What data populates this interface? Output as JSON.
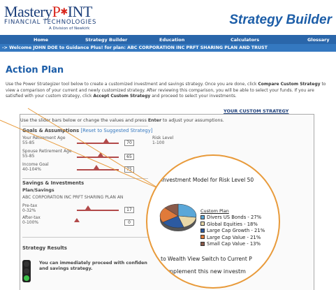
{
  "logo": {
    "name_a": "Mastery",
    "name_star": "P",
    "name_b": "INT",
    "sub": "FINANCIAL TECHNOLOGIES",
    "division": "A Division of Newkirk"
  },
  "brand": "Strategy Builder",
  "nav": [
    "Home",
    "Strategy Builder",
    "Education",
    "Calculators",
    "Glossary"
  ],
  "welcome": "-> Welcome JOHN DOE to Guidance Plus! for plan: ABC CORPORATION INC PRFT SHARING PLAN AND TRUST",
  "page_title": "Action Plan",
  "intro": {
    "p1": "Use the Power Strategizer tool below to create a customized investment and savings strategy. Once you are done, click ",
    "p1_bold": "Compare Custom Strategy",
    "p2": " to view a comparison of your current and newly customized strategy. After reviewing this comparison, you will be able to select your funds. If you are satisfied with your custom strategy, click ",
    "p2_bold": "Accept Custom Strategy",
    "p3": " and proceed to select your investments."
  },
  "your_custom_strategy": "YOUR CUSTOM STRATEGY",
  "instruction_a": "Use the slider bars below or change the values and press ",
  "instruction_bold": "Enter",
  "instruction_b": " to adjust your assumptions.",
  "goals": {
    "heading": "Goals & Assumptions",
    "reset_link": "[Reset to Suggested Strategy]",
    "retirement_age": {
      "label": "Your Retirement Age",
      "range": "55-85",
      "value": "70"
    },
    "spouse_age": {
      "label": "Spouse Retirement Age",
      "range": "55-85",
      "value": "65"
    },
    "income_goal": {
      "label": "Income Goal",
      "range": "40-104%",
      "value": "75"
    },
    "risk_level": {
      "label": "Risk Level",
      "range": "1-100"
    }
  },
  "savings": {
    "heading": "Savings & Investments",
    "sub": "Plan/Savings",
    "plan_name": "ABC CORPORATION INC PRFT SHARING PLAN AN",
    "pretax": {
      "label": "Pre-tax",
      "range": "0-32%",
      "value": "17"
    },
    "aftertax": {
      "label": "After-tax",
      "range": "0-100%",
      "value": "0"
    }
  },
  "results": {
    "heading": "Strategy Results",
    "message": "You can immediately proceed with confiden",
    "message2": "and savings strategy."
  },
  "zoom": {
    "title": "Investment Model for Risk Level 50",
    "legend_title": "Custom Plan",
    "links": "h to Wealth View   Switch to Current P",
    "bottom": "implement this new investm"
  },
  "chart_data": {
    "type": "pie",
    "title": "Investment Model for Risk Level 50",
    "legend_title": "Custom Plan",
    "categories": [
      "Divers US Bonds",
      "Global Equities",
      "Large Cap Growth",
      "Large Cap Value",
      "Small Cap Value"
    ],
    "values": [
      27,
      18,
      21,
      21,
      13
    ],
    "labels": [
      "Divers US Bonds - 27%",
      "Global Equities - 18%",
      "Large Cap Growth - 21%",
      "Large Cap Value - 21%",
      "Small Cap Value - 13%"
    ],
    "colors": [
      "#5aa7d8",
      "#e8d8a8",
      "#2c5aa0",
      "#e07a3a",
      "#8a5a4a"
    ]
  },
  "colors": {
    "primary": "#1d5ea8",
    "nav": "#2a66aa",
    "accent": "#e89a3a",
    "logo_red": "#d9261c"
  }
}
